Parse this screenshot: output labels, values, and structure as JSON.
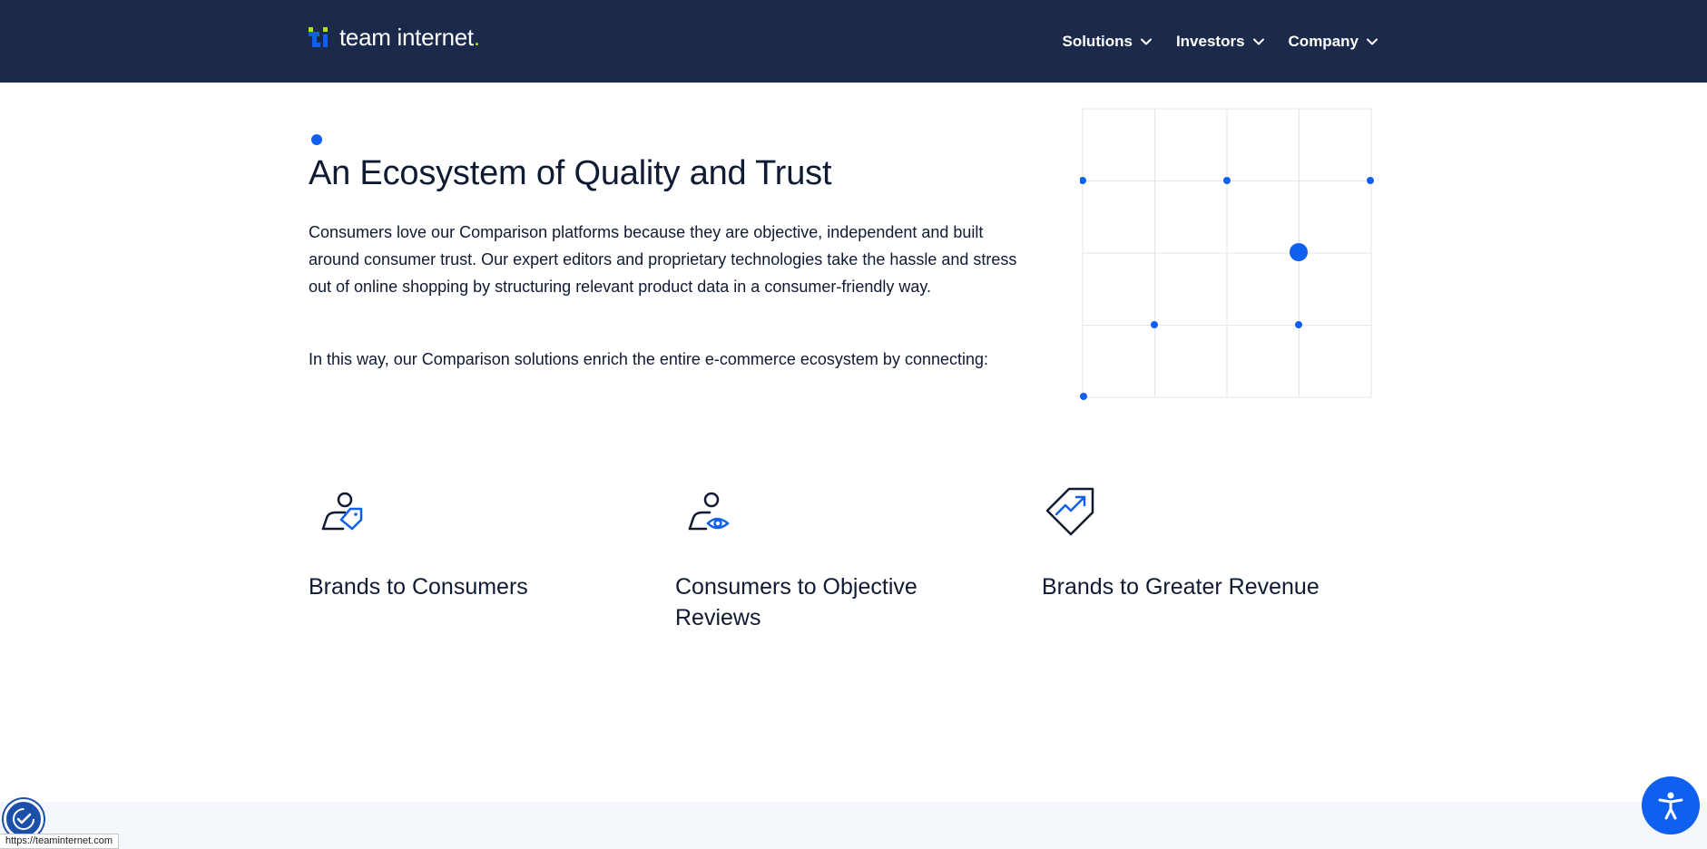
{
  "header": {
    "logo_text": "team internet",
    "logo_dot": ".",
    "nav": [
      {
        "label": "Solutions"
      },
      {
        "label": "Investors"
      },
      {
        "label": "Company"
      }
    ]
  },
  "main": {
    "title": "An Ecosystem of Quality and Trust",
    "paragraph_1": "Consumers love our Comparison platforms because they are objective, independent and built around consumer trust. Our expert editors and proprietary technologies take the hassle and stress out of online shopping by structuring relevant product data in a consumer-friendly way.",
    "paragraph_2": "In this way, our Comparison solutions enrich the entire e-commerce ecosystem by connecting:"
  },
  "features": [
    {
      "label": "Brands to Consumers",
      "icon": "person-tag-icon"
    },
    {
      "label": "Consumers to Objective Reviews",
      "icon": "person-eye-icon"
    },
    {
      "label": "Brands to Greater Revenue",
      "icon": "tag-growth-icon"
    }
  ],
  "status_bar": {
    "url": "https://teaminternet.com"
  },
  "colors": {
    "header_bg": "#1b2a4a",
    "accent_blue": "#1060f0",
    "logo_green": "#b6e01b",
    "text_dark": "#0f1a33",
    "band_bg": "#f4f7fc"
  }
}
